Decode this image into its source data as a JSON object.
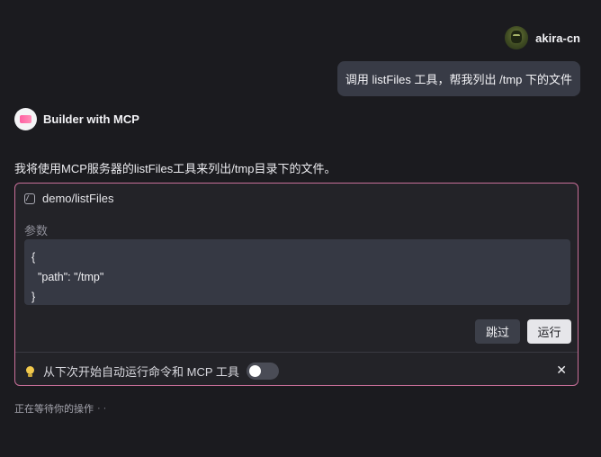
{
  "user": {
    "name": "akira-cn"
  },
  "user_message": "调用 listFiles 工具，帮我列出 /tmp 下的文件",
  "assistant": {
    "name": "Builder with MCP",
    "message": "我将使用MCP服务器的listFiles工具来列出/tmp目录下的文件。"
  },
  "tool_call": {
    "name": "demo/listFiles",
    "params_label": "参数",
    "params_json": "{\n  \"path\": \"/tmp\"\n}",
    "skip_label": "跳过",
    "run_label": "运行",
    "auto_run_label": "从下次开始自动运行命令和 MCP 工具",
    "auto_run_enabled": false
  },
  "status": {
    "text": "正在等待你的操作",
    "dots": "··"
  },
  "colors": {
    "card_border": "#c86f99",
    "background": "#1b1b1f",
    "bulb": "#f2c94c"
  },
  "icons": {
    "tool": "tool-icon",
    "bulb": "bulb-icon",
    "close": "close-icon"
  }
}
